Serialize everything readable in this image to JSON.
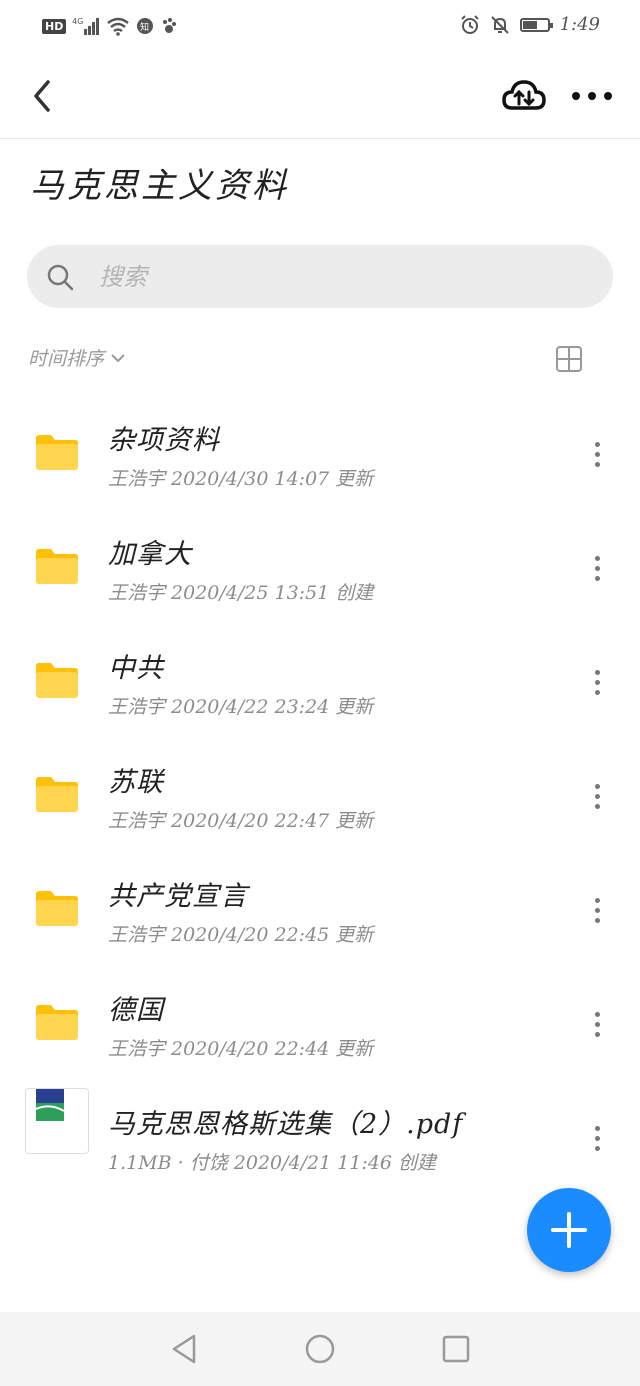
{
  "status": {
    "hd": "HD",
    "network": "4G",
    "time": "1:49",
    "battery_level": 0.6
  },
  "header": {
    "title": "马克思主义资料"
  },
  "search": {
    "placeholder": "搜索"
  },
  "sort": {
    "label": "时间排序"
  },
  "items": [
    {
      "type": "folder",
      "name": "杂项资料",
      "meta": "王浩宇 2020/4/30 14:07 更新"
    },
    {
      "type": "folder",
      "name": "加拿大",
      "meta": "王浩宇 2020/4/25 13:51 创建"
    },
    {
      "type": "folder",
      "name": "中共",
      "meta": "王浩宇 2020/4/22 23:24 更新"
    },
    {
      "type": "folder",
      "name": "苏联",
      "meta": "王浩宇 2020/4/20 22:47 更新"
    },
    {
      "type": "folder",
      "name": "共产党宣言",
      "meta": "王浩宇 2020/4/20 22:45 更新"
    },
    {
      "type": "folder",
      "name": "德国",
      "meta": "王浩宇 2020/4/20 22:44 更新"
    },
    {
      "type": "pdf",
      "name": "马克思恩格斯选集（2）.pdf",
      "meta": "1.1MB · 付饶 2020/4/21 11:46 创建"
    }
  ],
  "colors": {
    "accent": "#1a8cff",
    "folder": "#ffd54f",
    "folder_tab": "#ffc107"
  }
}
